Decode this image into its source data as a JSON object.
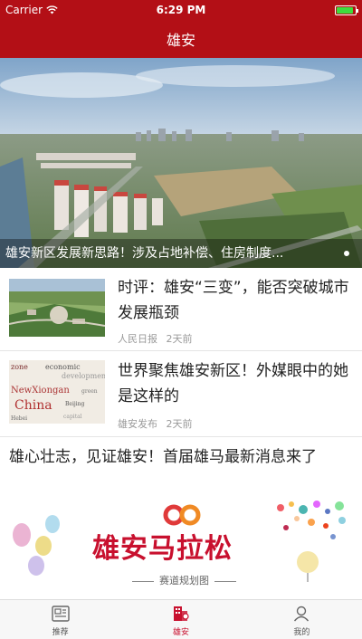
{
  "status_bar": {
    "carrier": "Carrier",
    "time": "6:29 PM",
    "battery_level": 0.9
  },
  "nav": {
    "title": "雄安"
  },
  "hero": {
    "caption": "雄安新区发展新思路！涉及占地补偿、住房制度..."
  },
  "news": [
    {
      "title": "时评：雄安“三变”，能否突破城市发展瓶颈",
      "source": "人民日报",
      "time": "2天前"
    },
    {
      "title": "世界聚焦雄安新区！外媒眼中的她是这样的",
      "source": "雄安发布",
      "time": "2天前"
    }
  ],
  "feature": {
    "title": "雄心壮志，见证雄安！首届雄马最新消息来了",
    "banner_title": "雄安马拉松",
    "banner_subtitle": "赛道规划图"
  },
  "tabs": [
    {
      "label": "推荐",
      "active": false
    },
    {
      "label": "雄安",
      "active": true
    },
    {
      "label": "我的",
      "active": false
    }
  ],
  "colors": {
    "brand": "#b30f16",
    "accent": "#c8102e"
  }
}
